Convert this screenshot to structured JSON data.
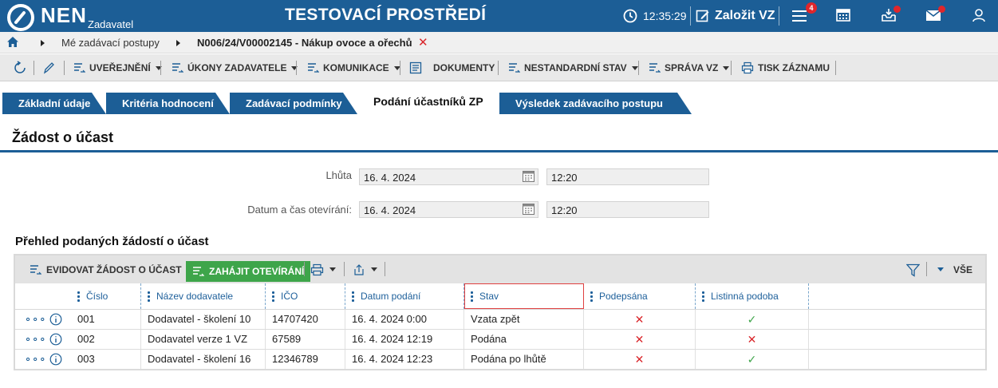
{
  "app": {
    "name": "NEN",
    "subtitle": "Zadavatel",
    "environment": "TESTOVACÍ PROSTŘEDÍ",
    "time": "12:35:29",
    "create_label": "Založit VZ",
    "menu_badge": "4"
  },
  "breadcrumb": {
    "item1": "Mé zadávací postupy",
    "item2": "N006/24/V00002145 - Nákup ovoce a ořechů"
  },
  "toolbar": {
    "items": [
      "UVEŘEJNĚNÍ",
      "ÚKONY ZADAVATELE",
      "KOMUNIKACE",
      "DOKUMENTY",
      "NESTANDARDNÍ STAV",
      "SPRÁVA VZ",
      "TISK ZÁZNAMU"
    ]
  },
  "tabs": [
    "Základní údaje",
    "Kritéria hodnocení",
    "Zadávací podmínky",
    "Podání účastníků ZP",
    "Výsledek zadávacího postupu"
  ],
  "section_title": "Žádost o účast",
  "form": {
    "lhuta_label": "Lhůta",
    "lhuta_date": "16. 4. 2024",
    "lhuta_time": "12:20",
    "otevirani_label": "Datum a čas otevírání:",
    "otevirani_date": "16. 4. 2024",
    "otevirani_time": "12:20"
  },
  "grid": {
    "title": "Přehled podaných žádostí o účast",
    "evidovat_label": "EVIDOVAT ŽÁDOST O ÚČAST",
    "zahajit_label": "ZAHÁJIT OTEVÍRÁNÍ",
    "filter_label": "VŠE",
    "columns": [
      "Číslo",
      "Název dodavatele",
      "IČO",
      "Datum podání",
      "Stav",
      "Podepsána",
      "Listinná podoba"
    ],
    "rows": [
      {
        "cislo": "001",
        "nazev": "Dodavatel - školení 10",
        "ico": "14707420",
        "datum": "16. 4. 2024 0:00",
        "stav": "Vzata zpět",
        "podepsana": "✕",
        "listinna": "✓"
      },
      {
        "cislo": "002",
        "nazev": "Dodavatel verze 1 VZ",
        "ico": "67589",
        "datum": "16. 4. 2024 12:19",
        "stav": "Podána",
        "podepsana": "✕",
        "listinna": "✕"
      },
      {
        "cislo": "003",
        "nazev": "Dodavatel - školení 16",
        "ico": "12346789",
        "datum": "16. 4. 2024 12:23",
        "stav": "Podána po lhůtě",
        "podepsana": "✕",
        "listinna": "✓"
      }
    ]
  },
  "colors": {
    "brand": "#1c5e96",
    "accent_red": "#d9262b",
    "accent_green": "#3ea54a"
  }
}
